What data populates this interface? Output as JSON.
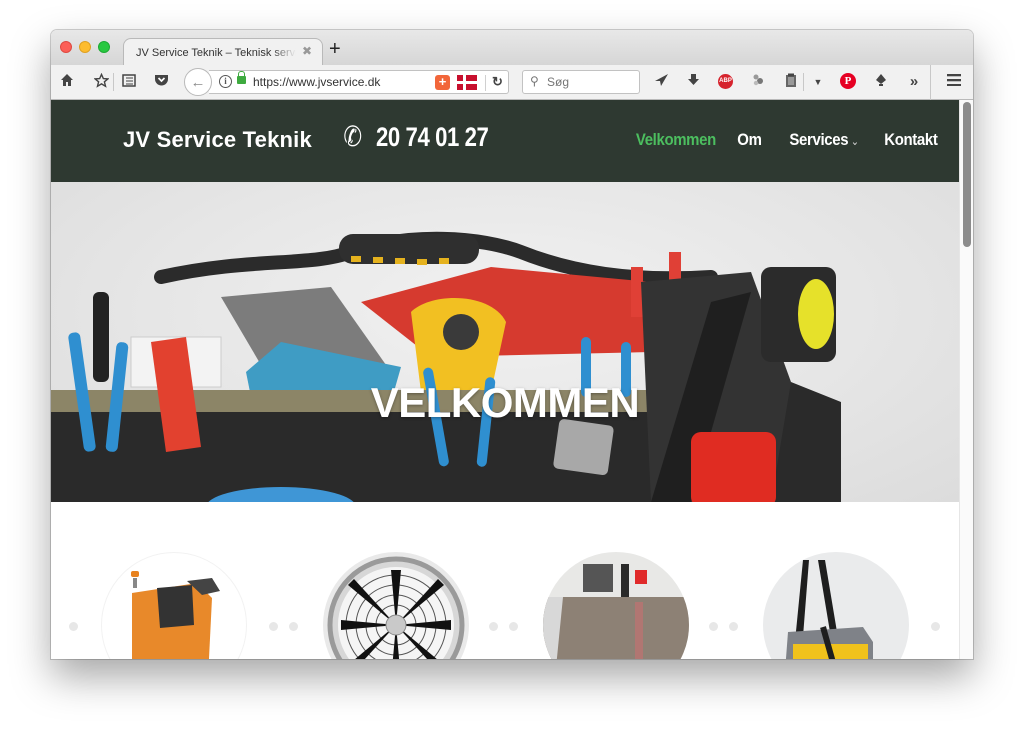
{
  "browser": {
    "tab": {
      "title": "JV Service Teknik – Teknisk service",
      "close_icon": "close-icon"
    },
    "new_tab_label": "+",
    "toolbar_icons": [
      "home-icon",
      "bookmark-star-icon",
      "reading-list-icon",
      "pocket-icon"
    ],
    "url": "https://www.jvservice.dk",
    "search": {
      "placeholder": "Søg",
      "value": ""
    },
    "extension_icons": [
      "send-icon",
      "download-icon",
      "adblock-plus-icon",
      "extension-icon",
      "clipboard-icon",
      "dropdown-icon",
      "pinterest-icon",
      "drum-icon",
      "overflow-icon",
      "menu-icon"
    ],
    "abp_label": "ABP",
    "pinterest_label": "P"
  },
  "site": {
    "brand": "JV Service Teknik",
    "phone_icon": "phone-icon",
    "phone": "20 74 01 27",
    "nav": [
      {
        "label": "Velkommen",
        "active": true
      },
      {
        "label": "Om",
        "active": false
      },
      {
        "label": "Services",
        "active": false,
        "has_dropdown": true
      },
      {
        "label": "Kontakt",
        "active": false
      }
    ],
    "accent_color": "#4cbe5f",
    "header_color": "#2e3931",
    "hero_title": "VELKOMMEN",
    "services": [
      {
        "name": "floor-scrubber",
        "alt": "Gulvskuremaskine"
      },
      {
        "name": "industrial-fan",
        "alt": "Ventilator"
      },
      {
        "name": "polished-floor",
        "alt": "Gulvbehandling"
      },
      {
        "name": "vacuum-cleaner",
        "alt": "Støvsuger"
      }
    ]
  }
}
